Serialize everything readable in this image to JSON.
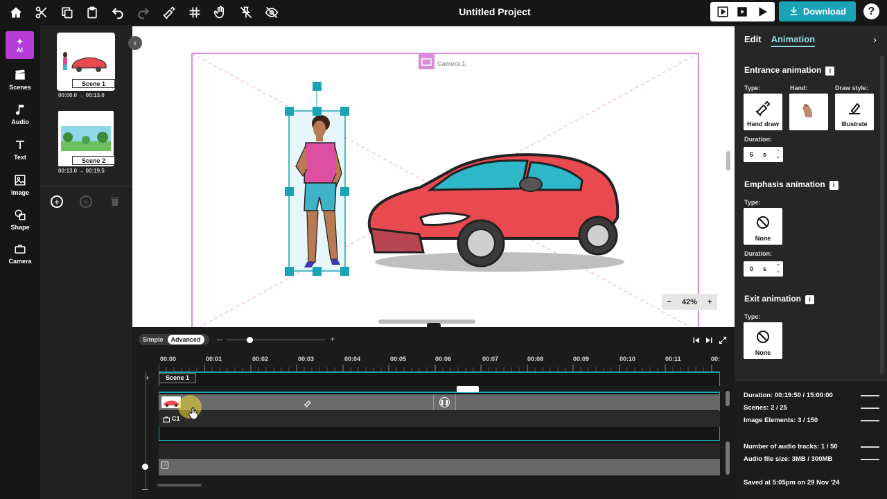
{
  "app": {
    "title": "Untitled Project",
    "download_label": "Download",
    "help_label": "?"
  },
  "leftnav": {
    "ai_label": "AI",
    "items": [
      {
        "label": "Scenes",
        "icon": "clapper-icon"
      },
      {
        "label": "Audio",
        "icon": "music-note-icon"
      },
      {
        "label": "Text",
        "icon": "text-icon"
      },
      {
        "label": "Image",
        "icon": "image-icon"
      },
      {
        "label": "Shape",
        "icon": "shape-icon"
      },
      {
        "label": "Camera",
        "icon": "camera-icon"
      }
    ]
  },
  "scenes": [
    {
      "label": "Scene 1",
      "start": "00:00.0",
      "end": "00:13.0"
    },
    {
      "label": "Scene 2",
      "start": "00:13.0",
      "end": "00:19.5"
    }
  ],
  "canvas": {
    "camera_label": "Camera 1",
    "zoom": "42%",
    "zoom_minus": "−",
    "zoom_plus": "+"
  },
  "timeline": {
    "mode_simple": "Simple",
    "mode_advanced": "Advanced",
    "ticks": [
      "00:00",
      "00:01",
      "00:02",
      "00:03",
      "00:04",
      "00:05",
      "00:06",
      "00:07",
      "00:08",
      "00:09",
      "00:10",
      "00:11",
      "00:"
    ],
    "scene_tag": "Scene 1",
    "camera_track_label": "C1"
  },
  "right_panel": {
    "tabs": [
      "Edit",
      "Animation"
    ],
    "active_tab": "Animation",
    "entrance": {
      "title": "Entrance animation",
      "type_label": "Type:",
      "hand_label": "Hand:",
      "draw_style_label": "Draw style:",
      "type_value": "Hand draw",
      "draw_style_value": "Illustrate",
      "duration_label": "Duration:",
      "duration_value": "6",
      "duration_unit": "s"
    },
    "emphasis": {
      "title": "Emphasis animation",
      "type_label": "Type:",
      "type_value": "None",
      "duration_label": "Duration:",
      "duration_value": "0",
      "duration_unit": "s"
    },
    "exit": {
      "title": "Exit animation",
      "type_label": "Type:",
      "type_value": "None"
    }
  },
  "stats": {
    "duration": "Duration: 00:19:50 / 15:00:00",
    "scenes": "Scenes: 2 / 25",
    "image_elements": "Image Elements: 3 / 150",
    "audio_tracks": "Number of audio tracks: 1 / 50",
    "audio_size": "Audio file size: 3MB / 300MB",
    "saved": "Saved at 5:05pm on 29 Nov '24"
  },
  "colors": {
    "accent": "#1aa3b5",
    "ai": "#b53cd6",
    "camera_frame": "#d98bdc",
    "selection": "#1aa3b5"
  }
}
